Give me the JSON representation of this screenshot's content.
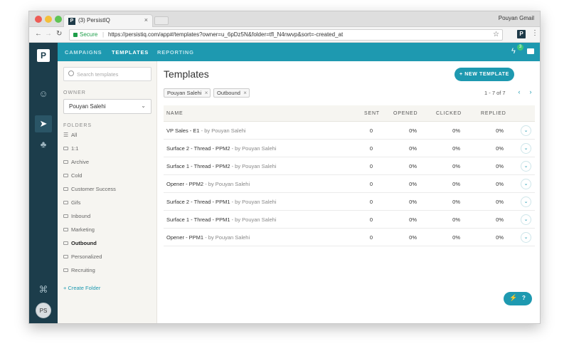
{
  "browser": {
    "tab_title": "(3) PersistIQ",
    "tab_favicon": "P",
    "tab_close": "×",
    "profile_name": "Pouyan Gmail",
    "secure_label": "Secure",
    "url": "https://persistiq.com/app#/templates?owner=u_6pDz5N&folder=tfl_N4nwvp&sort=-created_at",
    "extension_label": "P"
  },
  "app": {
    "logo": "P",
    "nav": [
      "CAMPAIGNS",
      "TEMPLATES",
      "REPORTING"
    ],
    "active_nav": "TEMPLATES",
    "notification_count": "3",
    "avatar_initials": "PS",
    "accent_color": "#1e99b0",
    "rail_color": "#1c3d4b"
  },
  "sidebar": {
    "search_placeholder": "Search templates",
    "owner_label": "OWNER",
    "owner_value": "Pouyan Salehi",
    "folders_label": "FOLDERS",
    "folders": [
      "All",
      "1:1",
      "Archive",
      "Cold",
      "Customer Success",
      "Gifs",
      "Inbound",
      "Marketing",
      "Outbound",
      "Personalized",
      "Recruiting"
    ],
    "active_folder": "Outbound",
    "create_folder": "+ Create Folder"
  },
  "main": {
    "title": "Templates",
    "new_template": "+ NEW TEMPLATE",
    "filters": [
      "Pouyan Salehi",
      "Outbound"
    ],
    "pagination": "1 - 7  of 7",
    "columns": [
      "NAME",
      "SENT",
      "OPENED",
      "CLICKED",
      "REPLIED"
    ],
    "rows": [
      {
        "name": "VP Sales - E1",
        "owner": " - by Pouyan Salehi",
        "sent": "0",
        "opened": "0%",
        "clicked": "0%",
        "replied": "0%"
      },
      {
        "name": "Surface 2 - Thread - PPM2",
        "owner": " - by Pouyan Salehi",
        "sent": "0",
        "opened": "0%",
        "clicked": "0%",
        "replied": "0%"
      },
      {
        "name": "Surface 1 - Thread - PPM2",
        "owner": " - by Pouyan Salehi",
        "sent": "0",
        "opened": "0%",
        "clicked": "0%",
        "replied": "0%"
      },
      {
        "name": "Opener - PPM2",
        "owner": " - by Pouyan Salehi",
        "sent": "0",
        "opened": "0%",
        "clicked": "0%",
        "replied": "0%"
      },
      {
        "name": "Surface 2 - Thread - PPM1",
        "owner": " - by Pouyan Salehi",
        "sent": "0",
        "opened": "0%",
        "clicked": "0%",
        "replied": "0%"
      },
      {
        "name": "Surface 1 - Thread - PPM1",
        "owner": " - by Pouyan Salehi",
        "sent": "0",
        "opened": "0%",
        "clicked": "0%",
        "replied": "0%"
      },
      {
        "name": "Opener - PPM1",
        "owner": " - by Pouyan Salehi",
        "sent": "0",
        "opened": "0%",
        "clicked": "0%",
        "replied": "0%"
      }
    ],
    "help_label": "?"
  }
}
